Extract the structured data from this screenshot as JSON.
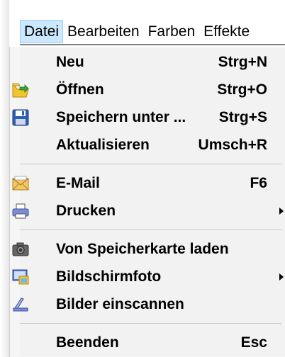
{
  "menubar": {
    "items": [
      "Datei",
      "Bearbeiten",
      "Farben",
      "Effekte"
    ]
  },
  "menu": {
    "new": {
      "label": "Neu",
      "shortcut": "Strg+N"
    },
    "open": {
      "label": "Öffnen",
      "shortcut": "Strg+O",
      "icon": "open-folder-icon"
    },
    "save_as": {
      "label": "Speichern unter ...",
      "shortcut": "Strg+S",
      "icon": "floppy-disk-icon"
    },
    "refresh": {
      "label": "Aktualisieren",
      "shortcut": "Umsch+R"
    },
    "email": {
      "label": "E-Mail",
      "shortcut": "F6",
      "icon": "email-envelope-icon"
    },
    "print": {
      "label": "Drucken",
      "icon": "printer-icon"
    },
    "card": {
      "label": "Von Speicherkarte laden",
      "icon": "camera-icon"
    },
    "screenshot": {
      "label": "Bildschirmfoto",
      "icon": "screenshot-icon"
    },
    "scan": {
      "label": "Bilder einscannen",
      "icon": "scanner-icon"
    },
    "exit": {
      "label": "Beenden",
      "shortcut": "Esc"
    }
  },
  "colors": {
    "active_menu_bg": "#cce8ff",
    "menu_bg": "#f2f2f2"
  }
}
